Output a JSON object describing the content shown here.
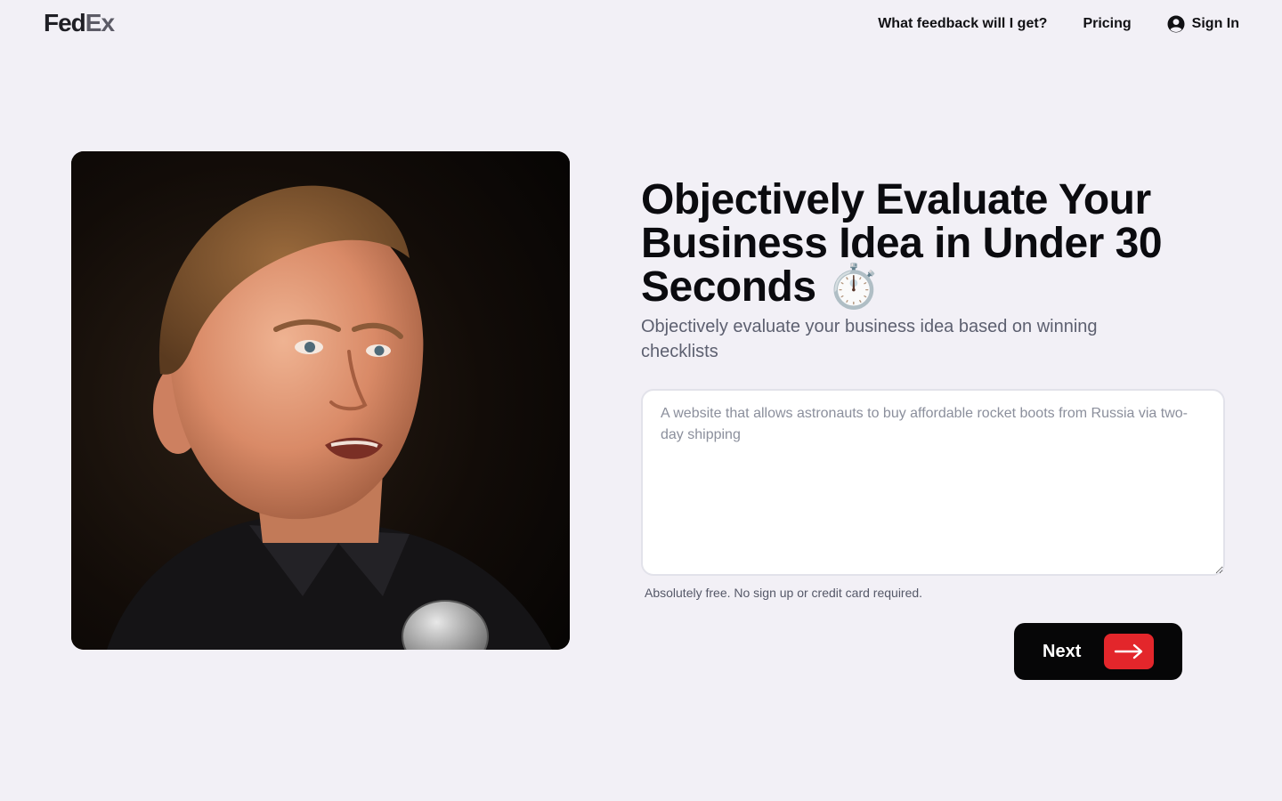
{
  "header": {
    "logo_left": "Fed",
    "logo_right": "Ex",
    "nav": [
      {
        "label": "What feedback will I get?"
      },
      {
        "label": "Pricing"
      }
    ],
    "signin_label": "Sign In",
    "signin_icon": "user-circle-icon"
  },
  "hero": {
    "photo_icon": "speaker-portrait",
    "headline": "Objectively Evaluate Your Business Idea in Under 30 Seconds ⏱️",
    "subtitle": "Objectively evaluate your business idea based on winning checklists",
    "idea_input": {
      "value": "",
      "placeholder": "A website that allows astronauts to buy affordable rocket boots from Russia via two-day shipping"
    },
    "note": "Absolutely free. No sign up or credit card required.",
    "next_label": "Next",
    "next_icon": "arrow-right-icon"
  },
  "colors": {
    "background": "#f2f0f6",
    "button": "#060607",
    "accent": "#e3262b",
    "subtitle": "#5d6070"
  }
}
